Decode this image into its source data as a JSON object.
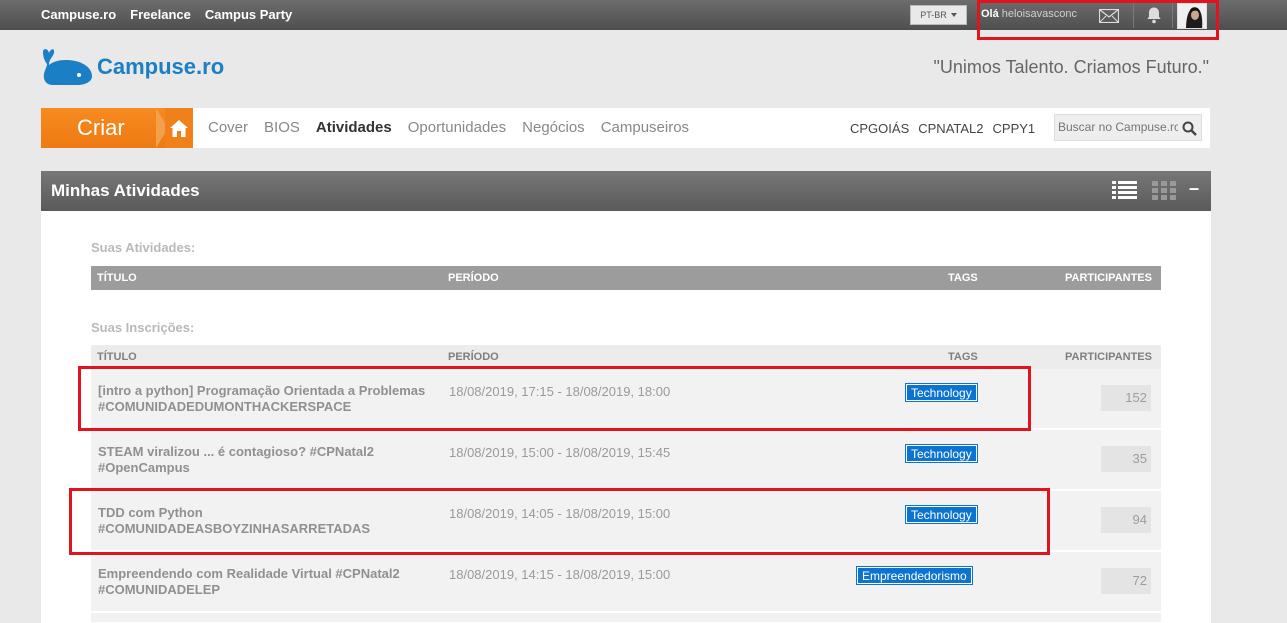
{
  "topbar": {
    "links": [
      "Campuse.ro",
      "Freelance",
      "Campus Party"
    ],
    "language": "PT-BR",
    "greeting": "Olá",
    "username": "heloisavasconc"
  },
  "header": {
    "brand": "Campuse.ro",
    "tagline": "\"Unimos Talento. Criamos Futuro.\""
  },
  "nav": {
    "criar": "Criar",
    "links": [
      "Cover",
      "BIOS",
      "Atividades",
      "Oportunidades",
      "Negócios",
      "Campuseiros"
    ],
    "active": "Atividades",
    "right_links": [
      "CPGOIÁS",
      "CPNATAL2",
      "CPPY1"
    ],
    "search_placeholder": "Buscar no Campuse.ro"
  },
  "panel": {
    "title": "Minhas Atividades",
    "collapse": "–"
  },
  "atividades": {
    "label": "Suas Atividades:",
    "columns": [
      "TÍTULO",
      "PERÍODO",
      "TAGS",
      "PARTICIPANTES"
    ]
  },
  "inscricoes": {
    "label": "Suas Inscrições:",
    "columns": [
      "TÍTULO",
      "PERÍODO",
      "TAGS",
      "PARTICIPANTES"
    ],
    "rows": [
      {
        "title": "[intro a python] Programação Orientada a Problemas #COMUNIDADEDUMONTHACKERSPACE",
        "period": "18/08/2019, 17:15  -  18/08/2019, 18:00",
        "tag": "Technology",
        "participants": "152"
      },
      {
        "title": "STEAM viralizou ... é contagioso? #CPNatal2 #OpenCampus",
        "period": "18/08/2019, 15:00  -  18/08/2019, 15:45",
        "tag": "Technology",
        "participants": "35"
      },
      {
        "title": "TDD com Python #COMUNIDADEASBOYZINHASARRETADAS",
        "period": "18/08/2019, 14:05  -  18/08/2019, 15:00",
        "tag": "Technology",
        "participants": "94"
      },
      {
        "title": "Empreendendo com Realidade Virtual #CPNatal2 #COMUNIDADELEP",
        "period": "18/08/2019, 14:15  -  18/08/2019, 15:00",
        "tag": "Empreendedorismo",
        "participants": "72"
      }
    ]
  },
  "colors": {
    "accent_orange": "#f68b1f",
    "brand_blue": "#1a7fc5",
    "tag_blue": "#0c73cf",
    "highlight_red": "#e0141f"
  }
}
